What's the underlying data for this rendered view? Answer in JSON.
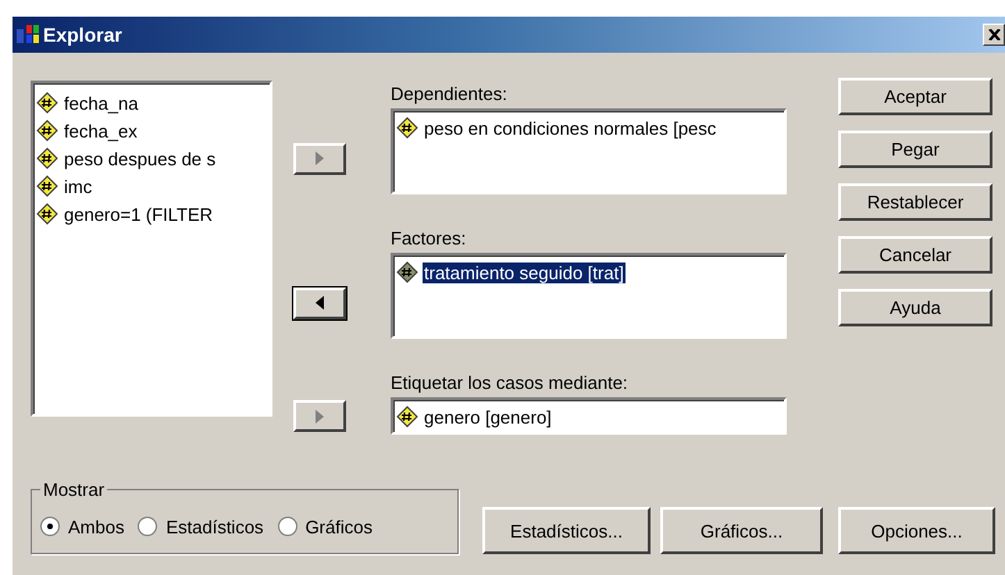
{
  "window": {
    "title": "Explorar"
  },
  "source_variables": [
    {
      "name": "fecha_na",
      "selected": false
    },
    {
      "name": "fecha_ex",
      "selected": false
    },
    {
      "name": "peso despues de s",
      "selected": false
    },
    {
      "name": "imc",
      "selected": false
    },
    {
      "name": "genero=1 (FILTER",
      "selected": false
    }
  ],
  "targets": [
    {
      "label": "Dependientes:",
      "kind": "right",
      "arrow_disabled": true,
      "multiline": true,
      "items": [
        {
          "name": "peso en condiciones normales [pesc",
          "selected": false
        }
      ]
    },
    {
      "label": "Factores:",
      "kind": "left",
      "arrow_disabled": false,
      "multiline": true,
      "items": [
        {
          "name": "tratamiento seguido [trat]",
          "selected": true
        }
      ]
    },
    {
      "label": "Etiquetar los casos mediante:",
      "kind": "right",
      "arrow_disabled": true,
      "multiline": false,
      "items": [
        {
          "name": "genero [genero]",
          "selected": false
        }
      ]
    }
  ],
  "side_buttons": [
    "Aceptar",
    "Pegar",
    "Restablecer",
    "Cancelar",
    "Ayuda"
  ],
  "display_group": {
    "title": "Mostrar",
    "options": [
      {
        "label": "Ambos",
        "selected": true
      },
      {
        "label": "Estadísticos",
        "selected": false
      },
      {
        "label": "Gráficos",
        "selected": false
      }
    ]
  },
  "bottom_buttons": [
    "Estadísticos...",
    "Gráficos...",
    "Opciones..."
  ]
}
